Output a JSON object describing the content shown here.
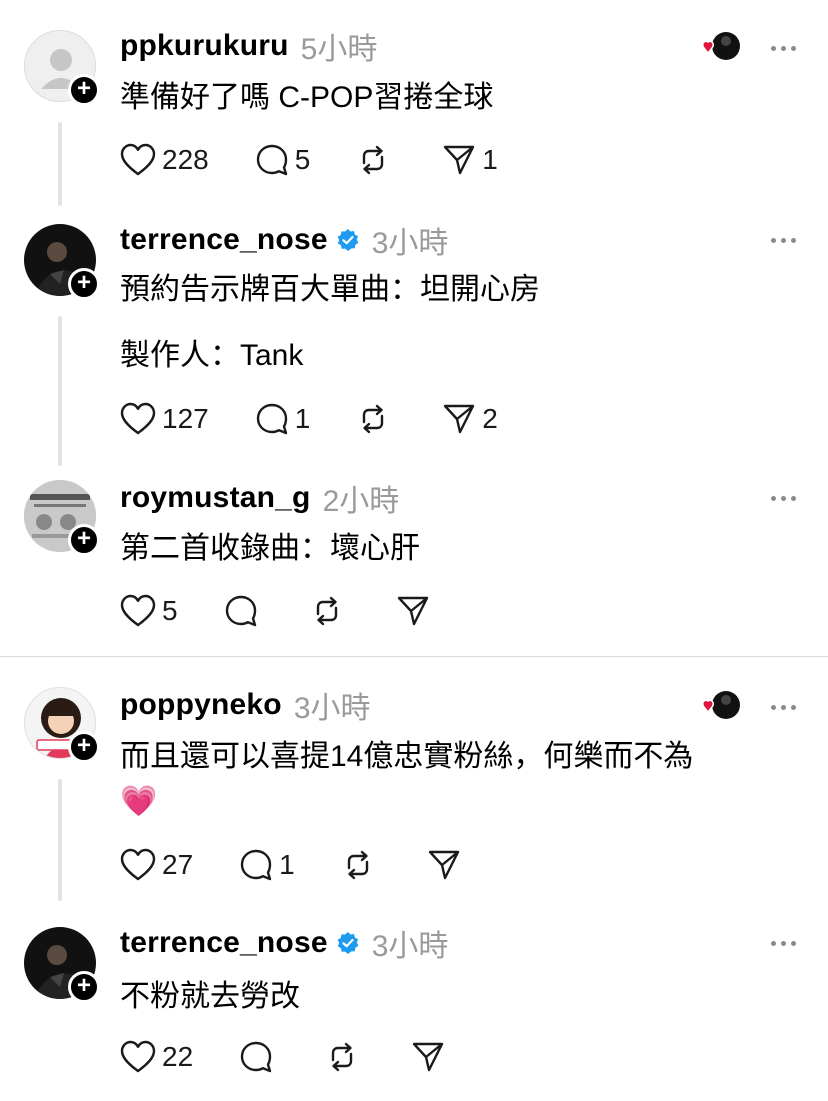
{
  "posts": [
    {
      "username": "ppkurukuru",
      "time": "5小時",
      "verified": false,
      "text": [
        "準備好了嗎 C-POP習捲全球"
      ],
      "likes": "228",
      "replies": "5",
      "reposts": "",
      "shares": "1",
      "liked_by_author": true
    },
    {
      "username": "terrence_nose",
      "time": "3小時",
      "verified": true,
      "text": [
        "預約告示牌百大單曲：坦開心房",
        "製作人：Tank"
      ],
      "likes": "127",
      "replies": "1",
      "reposts": "",
      "shares": "2",
      "liked_by_author": false
    },
    {
      "username": "roymustan_g",
      "time": "2小時",
      "verified": false,
      "text": [
        "第二首收錄曲：壞心肝"
      ],
      "likes": "5",
      "replies": "",
      "reposts": "",
      "shares": "",
      "liked_by_author": false
    },
    {
      "username": "poppyneko",
      "time": "3小時",
      "verified": false,
      "text": [
        "而且還可以喜提14億忠實粉絲，何樂而不為",
        "💗"
      ],
      "likes": "27",
      "replies": "1",
      "reposts": "",
      "shares": "",
      "liked_by_author": true
    },
    {
      "username": "terrence_nose",
      "time": "3小時",
      "verified": true,
      "text": [
        "不粉就去勞改"
      ],
      "likes": "22",
      "replies": "",
      "reposts": "",
      "shares": "",
      "liked_by_author": false
    }
  ],
  "icons": {
    "like": "heart-outline-icon",
    "reply": "comment-bubble-icon",
    "repost": "repost-arrows-icon",
    "share": "send-paper-plane-icon",
    "more": "more-horizontal-icon",
    "verified": "verified-badge-icon",
    "follow": "plus-icon",
    "liked_by_author": "author-liked-heart-icon"
  },
  "colors": {
    "text": "#000000",
    "muted": "#9a9a9a",
    "verified": "#1d9bf0",
    "heart": "#e0143c",
    "divider": "#dadada"
  }
}
